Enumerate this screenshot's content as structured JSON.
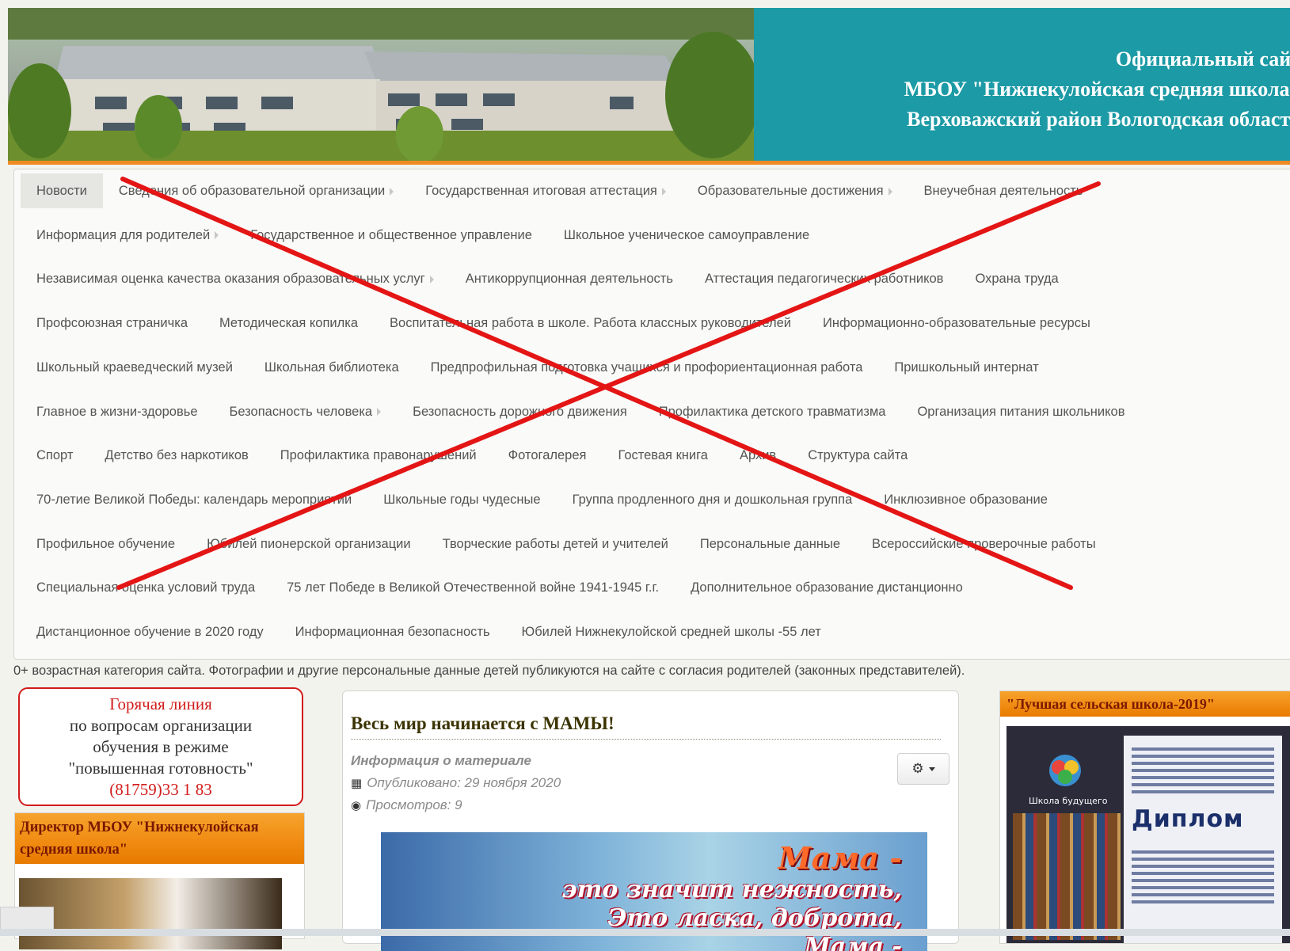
{
  "header": {
    "title_line1": "Официальный сайт",
    "title_line2": "МБОУ \"Нижнекулойская средняя школа\"",
    "title_line3": "Верховажский район Вологодская область"
  },
  "nav": {
    "rows": [
      [
        {
          "label": "Новости",
          "active": true
        },
        {
          "label": "Сведения об образовательной организации",
          "submenu": true
        },
        {
          "label": "Государственная итоговая аттестация",
          "submenu": true
        },
        {
          "label": "Образовательные достижения",
          "submenu": true
        },
        {
          "label": "Внеучебная деятельность"
        }
      ],
      [
        {
          "label": "Информация для родителей",
          "submenu": true
        },
        {
          "label": "Государственное и общественное управление"
        },
        {
          "label": "Школьное ученическое самоуправление"
        }
      ],
      [
        {
          "label": "Независимая оценка качества оказания образовательных услуг",
          "submenu": true
        },
        {
          "label": "Антикоррупционная деятельность"
        },
        {
          "label": "Аттестация педагогических работников"
        },
        {
          "label": "Охрана труда"
        }
      ],
      [
        {
          "label": "Профсоюзная страничка"
        },
        {
          "label": "Методическая копилка"
        },
        {
          "label": "Воспитательная работа в школе. Работа классных руководителей"
        },
        {
          "label": "Информационно-образовательные ресурсы"
        }
      ],
      [
        {
          "label": "Школьный краеведческий музей"
        },
        {
          "label": "Школьная библиотека"
        },
        {
          "label": "Предпрофильная подготовка учащихся и профориентационная работа"
        },
        {
          "label": "Пришкольный интернат"
        }
      ],
      [
        {
          "label": "Главное в жизни-здоровье"
        },
        {
          "label": "Безопасность человека",
          "submenu": true
        },
        {
          "label": "Безопасность дорожного движения"
        },
        {
          "label": "Профилактика детского травматизма"
        },
        {
          "label": "Организация питания школьников"
        }
      ],
      [
        {
          "label": "Спорт"
        },
        {
          "label": "Детство без наркотиков"
        },
        {
          "label": "Профилактика правонарушений"
        },
        {
          "label": "Фотогалерея"
        },
        {
          "label": "Гостевая книга"
        },
        {
          "label": "Архив"
        },
        {
          "label": "Структура сайта"
        }
      ],
      [
        {
          "label": "70-летие Великой Победы: календарь мероприятий"
        },
        {
          "label": "Школьные годы чудесные"
        },
        {
          "label": "Группа продленного дня и дошкольная группа"
        },
        {
          "label": "Инклюзивное образование"
        }
      ],
      [
        {
          "label": "Профильное обучение"
        },
        {
          "label": "Юбилей пионерской организации"
        },
        {
          "label": "Творческие работы детей и учителей"
        },
        {
          "label": "Персональные данные"
        },
        {
          "label": "Всероссийские проверочные работы"
        }
      ],
      [
        {
          "label": "Специальная оценка условий труда"
        },
        {
          "label": "75 лет Победе в Великой Отечественной войне 1941-1945 г.г."
        },
        {
          "label": "Дополнительное образование дистанционно"
        }
      ],
      [
        {
          "label": "Дистанционное обучение в 2020 году"
        },
        {
          "label": "Информационная безопасность"
        },
        {
          "label": "Юбилей Нижнекулойской средней школы -55 лет"
        }
      ]
    ]
  },
  "age_note": "0+ возрастная категория сайта. Фотографии и другие персональные данные детей публикуются на сайте с согласия родителей (законных представителей).",
  "hotline": {
    "title": "Горячая линия",
    "line1": "по вопросам организации",
    "line2": "обучения в режиме",
    "line3": "\"повышенная готовность\"",
    "phone": "(81759)33 1 83"
  },
  "director": {
    "heading": "Директор МБОУ \"Нижнекулойская средняя школа\""
  },
  "article": {
    "title": "Весь мир начинается с МАМЫ!",
    "info_label": "Информация о материале",
    "published": "Опубликовано: 29 ноября 2020",
    "views": "Просмотров: 9",
    "image_text1": "Мама -",
    "image_text2": "это значит нежность,",
    "image_text3": "Это ласка, доброта,",
    "image_text4": "Мама -"
  },
  "right": {
    "heading": "\"Лучшая сельская школа-2019\"",
    "diploma_word": "Диплом",
    "logo_text": "Школа будущего"
  },
  "colors": {
    "header_teal": "#1c9aa5",
    "accent_orange": "#f08a23",
    "hotline_red": "#d21b1b",
    "overlay_red": "#e41515"
  },
  "icons": {
    "published": "calendar-icon",
    "views": "eye-icon",
    "tools": "gear-icon"
  }
}
